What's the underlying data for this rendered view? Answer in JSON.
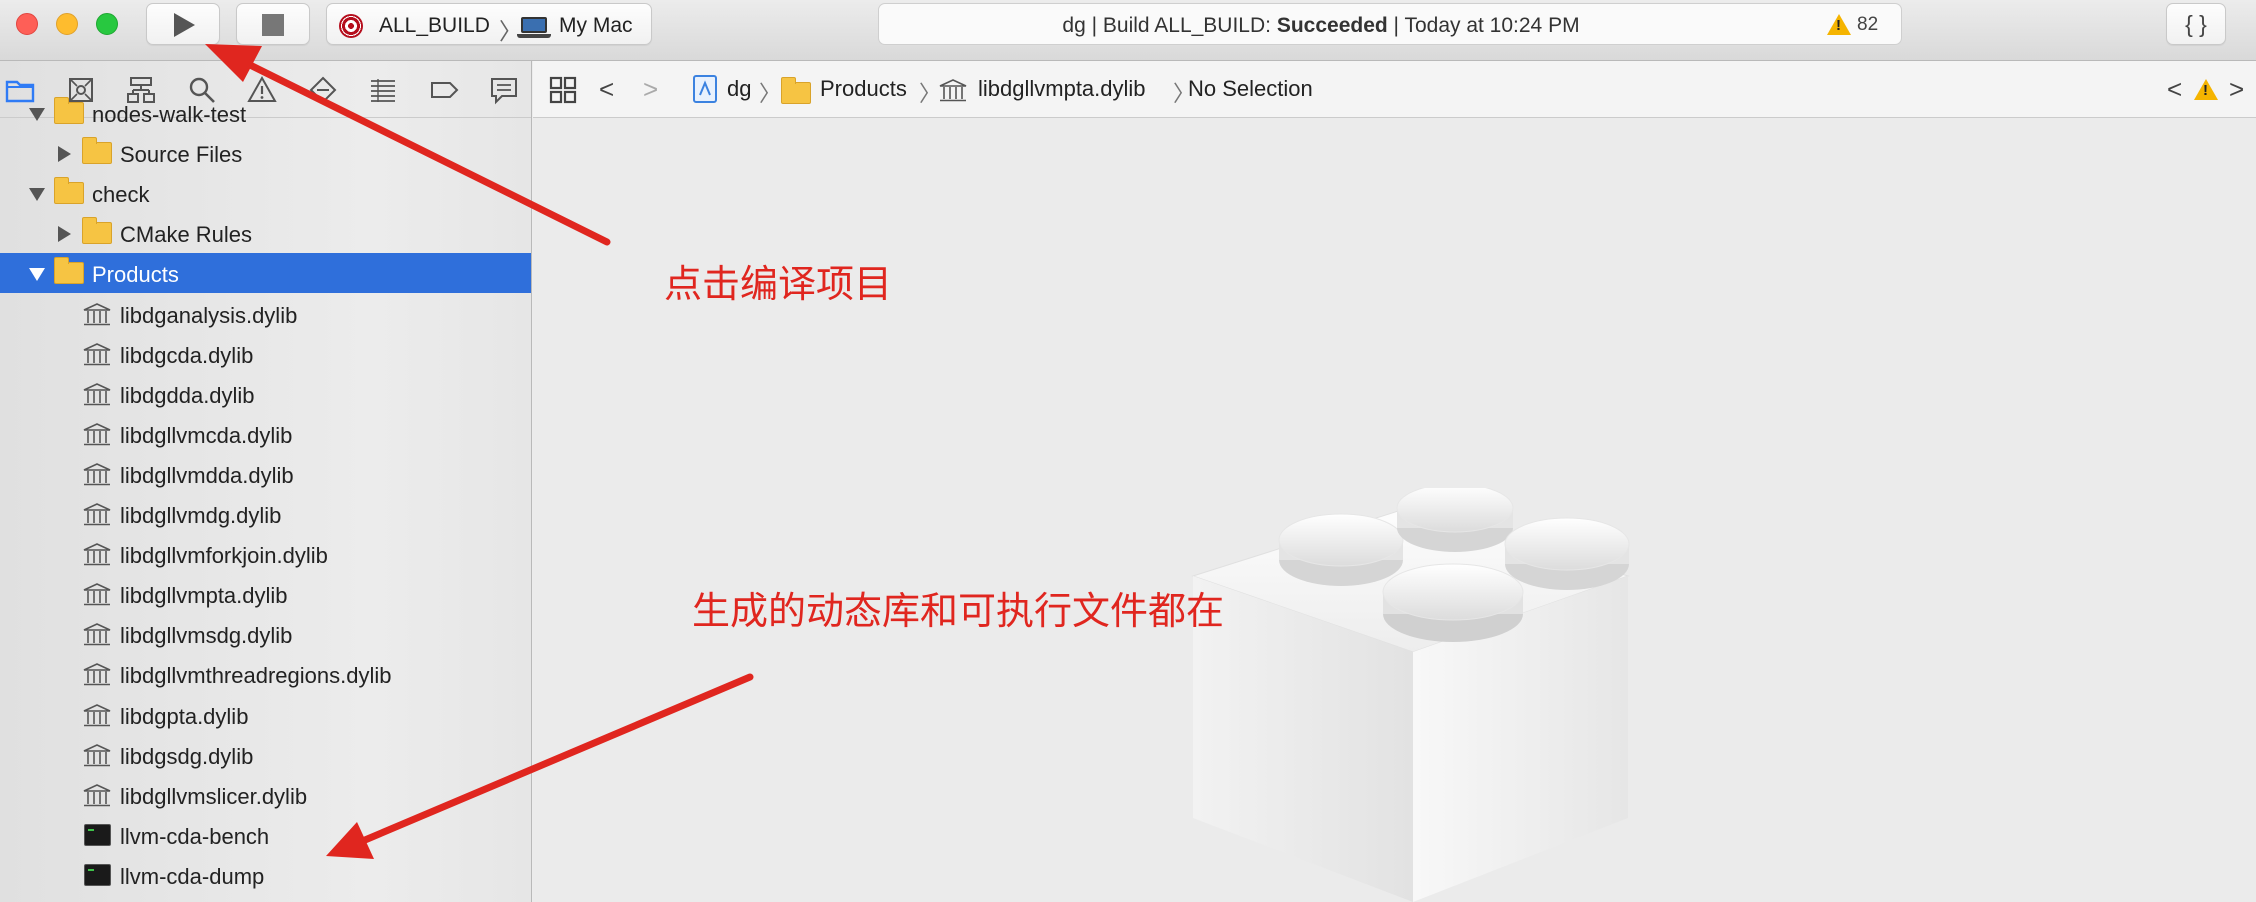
{
  "toolbar": {
    "scheme": "ALL_BUILD",
    "destination": "My Mac",
    "activity_status_prefix": "dg | Build ALL_BUILD: ",
    "activity_status_result": "Succeeded",
    "activity_status_suffix": " | Today at 10:24 PM",
    "warning_count": "82",
    "code_review_label": "{ }"
  },
  "navigator": {
    "tabs": [
      "folder-icon",
      "source-control-icon",
      "hierarchy-icon",
      "search-icon",
      "issue-icon",
      "test-icon",
      "debug-icon",
      "breakpoint-icon",
      "report-icon"
    ],
    "tree": [
      {
        "label": "nodes-walk-test",
        "type": "folder",
        "level": 0,
        "expanded": true
      },
      {
        "label": "Source Files",
        "type": "folder",
        "level": 1,
        "expanded": false
      },
      {
        "label": "check",
        "type": "folder",
        "level": 0,
        "expanded": true
      },
      {
        "label": "CMake Rules",
        "type": "folder",
        "level": 1,
        "expanded": false
      },
      {
        "label": "Products",
        "type": "folder",
        "level": 0,
        "expanded": true,
        "selected": true
      },
      {
        "label": "libdganalysis.dylib",
        "type": "library",
        "level": 1
      },
      {
        "label": "libdgcda.dylib",
        "type": "library",
        "level": 1
      },
      {
        "label": "libdgdda.dylib",
        "type": "library",
        "level": 1
      },
      {
        "label": "libdgllvmcda.dylib",
        "type": "library",
        "level": 1
      },
      {
        "label": "libdgllvmdda.dylib",
        "type": "library",
        "level": 1
      },
      {
        "label": "libdgllvmdg.dylib",
        "type": "library",
        "level": 1
      },
      {
        "label": "libdgllvmforkjoin.dylib",
        "type": "library",
        "level": 1
      },
      {
        "label": "libdgllvmpta.dylib",
        "type": "library",
        "level": 1
      },
      {
        "label": "libdgllvmsdg.dylib",
        "type": "library",
        "level": 1
      },
      {
        "label": "libdgllvmthreadregions.dylib",
        "type": "library",
        "level": 1
      },
      {
        "label": "libdgpta.dylib",
        "type": "library",
        "level": 1
      },
      {
        "label": "libdgsdg.dylib",
        "type": "library",
        "level": 1
      },
      {
        "label": "libdgllvmslicer.dylib",
        "type": "library",
        "level": 1
      },
      {
        "label": "llvm-cda-bench",
        "type": "executable",
        "level": 1
      },
      {
        "label": "llvm-cda-dump",
        "type": "executable",
        "level": 1
      }
    ]
  },
  "jump_bar": {
    "project": "dg",
    "group": "Products",
    "file": "libdgllvmpta.dylib",
    "selection": "No Selection"
  },
  "annotations": {
    "build_hint": "点击编译项目",
    "output_hint": "生成的动态库和可执行文件都在"
  },
  "colors": {
    "annotation": "#e0261f",
    "selection": "#2f6fdb",
    "warning": "#f5b400"
  }
}
